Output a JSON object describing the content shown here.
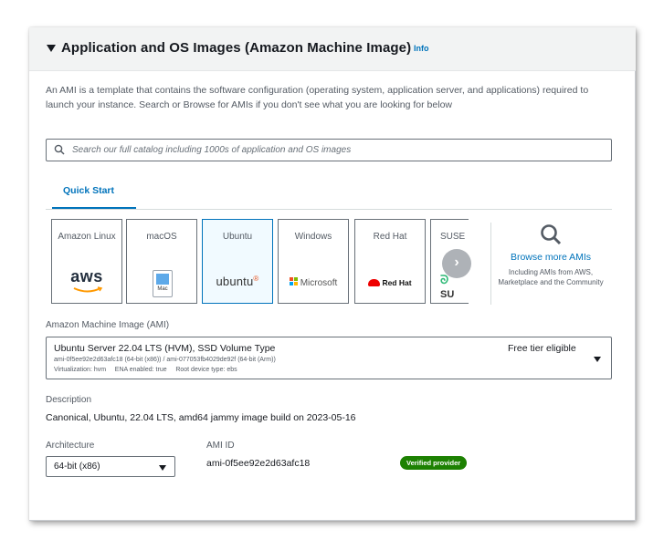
{
  "section": {
    "title": "Application and OS Images (Amazon Machine Image)",
    "info_label": "Info",
    "description": "An AMI is a template that contains the software configuration (operating system, application server, and applications) required to launch your instance. Search or Browse for AMIs if you don't see what you are looking for below"
  },
  "search": {
    "placeholder": "Search our full catalog including 1000s of application and OS images",
    "icon": "search-icon"
  },
  "tabs": [
    {
      "label": "Quick Start",
      "selected": true
    }
  ],
  "quick_start": {
    "tiles": [
      {
        "label": "Amazon Linux",
        "logo": "aws",
        "selected": false
      },
      {
        "label": "macOS",
        "logo": "Mac",
        "selected": false
      },
      {
        "label": "Ubuntu",
        "logo": "ubuntu",
        "selected": true
      },
      {
        "label": "Windows",
        "logo": "Microsoft",
        "selected": false
      },
      {
        "label": "Red Hat",
        "logo": "Red Hat",
        "selected": false
      },
      {
        "label": "SUSE",
        "logo": "SU",
        "selected": false
      }
    ],
    "next_icon": "chevron-right-icon",
    "browse": {
      "title": "Browse more AMIs",
      "subtitle": "Including AMIs from AWS, Marketplace and the Community",
      "icon": "search-icon"
    }
  },
  "ami": {
    "label": "Amazon Machine Image (AMI)",
    "name": "Ubuntu Server 22.04 LTS (HVM), SSD Volume Type",
    "ids": "ami-0f5ee92e2d63afc18 (64-bit (x86)) / ami-077053fb4029de92f (64-bit (Arm))",
    "meta": "Virtualization: hvm     ENA enabled: true     Root device type: ebs",
    "badge": "Free tier eligible"
  },
  "description": {
    "label": "Description",
    "text": "Canonical, Ubuntu, 22.04 LTS, amd64 jammy image build on 2023-05-16"
  },
  "architecture": {
    "label": "Architecture",
    "value": "64-bit (x86)"
  },
  "ami_id": {
    "label": "AMI ID",
    "value": "ami-0f5ee92e2d63afc18",
    "provider_badge": "Verified provider"
  },
  "colors": {
    "link": "#0073bb",
    "selected_border": "#0073bb",
    "verified_badge": "#1d8102",
    "ubuntu_accent": "#e95420"
  }
}
